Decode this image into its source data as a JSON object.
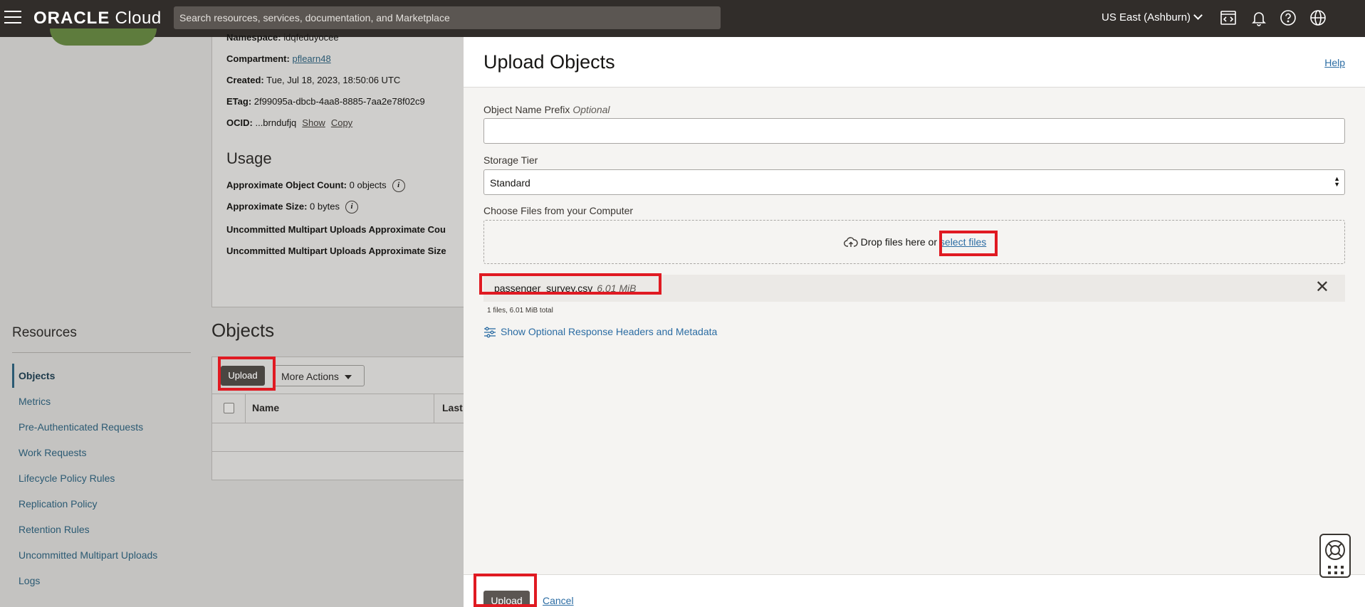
{
  "header": {
    "brand_bold": "ORACLE",
    "brand_rest": " Cloud",
    "search_placeholder": "Search resources, services, documentation, and Marketplace",
    "region": "US East (Ashburn)",
    "icons": [
      "menu-icon",
      "code-editor-icon",
      "bell-icon",
      "help-icon",
      "globe-icon"
    ]
  },
  "bucket_details": {
    "namespace_label": "Namespace:",
    "namespace_value": "idqfeduyocee",
    "compartment_label": "Compartment:",
    "compartment_value": "pflearn48",
    "created_label": "Created:",
    "created_value": "Tue, Jul 18, 2023, 18:50:06 UTC",
    "etag_label": "ETag:",
    "etag_value": "2f99095a-dbcb-4aa8-8885-7aa2e78f02c9",
    "ocid_label": "OCID:",
    "ocid_value": "...brndufjq",
    "ocid_show": "Show",
    "ocid_copy": "Copy"
  },
  "usage": {
    "title": "Usage",
    "object_count_label": "Approximate Object Count:",
    "object_count_value": "0 objects",
    "size_label": "Approximate Size:",
    "size_value": "0 bytes",
    "multipart_count_label": "Uncommitted Multipart Uploads Approximate Cou",
    "multipart_size_label": "Uncommitted Multipart Uploads Approximate Size"
  },
  "resources": {
    "title": "Resources",
    "items": [
      {
        "label": "Objects",
        "active": true
      },
      {
        "label": "Metrics"
      },
      {
        "label": "Pre-Authenticated Requests"
      },
      {
        "label": "Work Requests"
      },
      {
        "label": "Lifecycle Policy Rules"
      },
      {
        "label": "Replication Policy"
      },
      {
        "label": "Retention Rules"
      },
      {
        "label": "Uncommitted Multipart Uploads"
      },
      {
        "label": "Logs"
      }
    ]
  },
  "objects": {
    "title": "Objects",
    "upload_label": "Upload",
    "more_actions_label": "More Actions",
    "columns": [
      "Name",
      "Last"
    ]
  },
  "panel": {
    "title": "Upload Objects",
    "help_label": "Help",
    "prefix_label": "Object Name Prefix",
    "prefix_optional": "Optional",
    "prefix_value": "",
    "tier_label": "Storage Tier",
    "tier_value": "Standard",
    "choose_label": "Choose Files from your Computer",
    "drop_text": "Drop files here or ",
    "select_files": "select files",
    "file_name": "passenger_survey.csv",
    "file_size": "6.01 MiB",
    "file_total": "1 files, 6.01 MiB total",
    "optional_headers_link": "Show Optional Response Headers and Metadata",
    "upload_button": "Upload",
    "cancel_link": "Cancel"
  },
  "colors": {
    "topbar": "#312d2a",
    "link": "#2b6ca3",
    "highlight": "#e01a22",
    "primary_button": "#5b5652"
  }
}
